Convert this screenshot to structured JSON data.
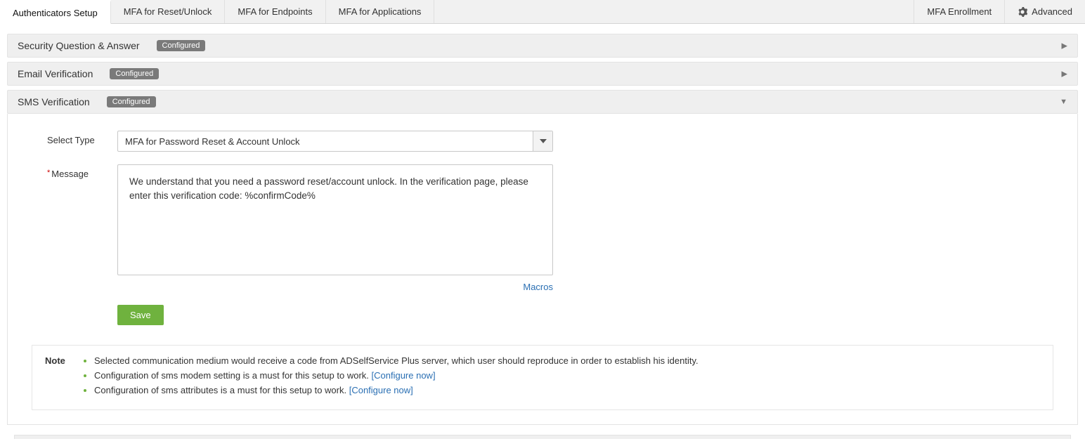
{
  "tabs": {
    "authenticators_setup": "Authenticators Setup",
    "mfa_reset_unlock": "MFA for Reset/Unlock",
    "mfa_endpoints": "MFA for Endpoints",
    "mfa_applications": "MFA for Applications",
    "mfa_enrollment": "MFA Enrollment",
    "advanced": "Advanced"
  },
  "accordions": {
    "security_qa": {
      "title": "Security Question & Answer",
      "badge": "Configured"
    },
    "email_verification": {
      "title": "Email Verification",
      "badge": "Configured"
    },
    "sms_verification": {
      "title": "SMS Verification",
      "badge": "Configured"
    }
  },
  "form": {
    "select_type_label": "Select Type",
    "select_type_value": "MFA for Password Reset & Account Unlock",
    "message_label": "Message",
    "message_value": "We understand that you need a password reset/account unlock. In the verification page, please enter this verification code: %confirmCode%",
    "macros_link": "Macros",
    "save_label": "Save"
  },
  "note": {
    "label": "Note",
    "items": {
      "i0": {
        "text": "Selected communication medium would receive a code from ADSelfService Plus server, which user should reproduce in order to establish his identity."
      },
      "i1": {
        "text": "Configuration of sms modem setting is a must for this setup to work. ",
        "link": "[Configure now]"
      },
      "i2": {
        "text": "Configuration of sms attributes is a must for this setup to work. ",
        "link": "[Configure now]"
      }
    }
  }
}
